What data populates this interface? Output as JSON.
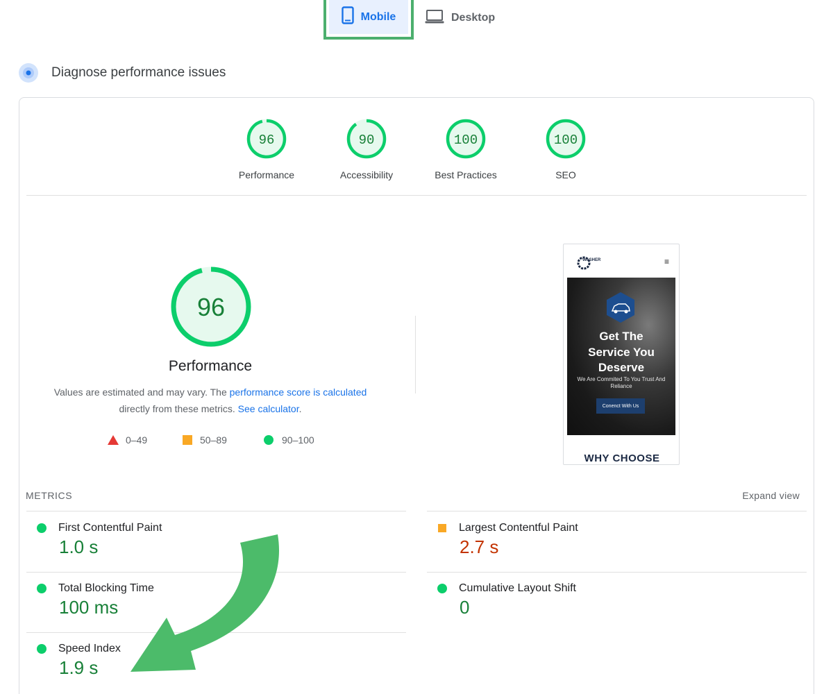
{
  "tabs": {
    "mobile": {
      "label": "Mobile",
      "icon": "phone-icon",
      "selected": true
    },
    "desktop": {
      "label": "Desktop",
      "icon": "laptop-icon",
      "selected": false
    }
  },
  "header": {
    "title": "Diagnose performance issues",
    "icon": "diagnose-icon"
  },
  "categories": [
    {
      "score": "96",
      "label": "Performance",
      "value": 96
    },
    {
      "score": "90",
      "label": "Accessibility",
      "value": 90
    },
    {
      "score": "100",
      "label": "Best Practices",
      "value": 100
    },
    {
      "score": "100",
      "label": "SEO",
      "value": 100
    }
  ],
  "performance": {
    "score": "96",
    "value": 96,
    "title": "Performance",
    "desc_prefix": "Values are estimated and may vary. The ",
    "desc_link": "performance score is calculated",
    "desc_middle": "directly from these metrics. ",
    "calculator_link": "See calculator",
    "desc_suffix": "."
  },
  "legend": [
    {
      "shape": "triangle",
      "range": "0–49",
      "color": "#e53935"
    },
    {
      "shape": "square",
      "range": "50–89",
      "color": "#f9a825"
    },
    {
      "shape": "circle",
      "range": "90–100",
      "color": "#0cce6b"
    }
  ],
  "screenshot": {
    "logo_text": "WASHER",
    "menu_icon": "≡",
    "hero_title_1": "Get The",
    "hero_title_2": "Service You",
    "hero_title_3": "Deserve",
    "hero_sub": "We Are Commited To You Trust And Reliance",
    "hero_button": "Conenct With Us",
    "section_heading": "WHY CHOOSE"
  },
  "metrics": {
    "title": "METRICS",
    "expand_label": "Expand view",
    "items": [
      {
        "name": "First Contentful Paint",
        "value": "1.0 s",
        "status": "pass"
      },
      {
        "name": "Largest Contentful Paint",
        "value": "2.7 s",
        "status": "average"
      },
      {
        "name": "Total Blocking Time",
        "value": "100 ms",
        "status": "pass"
      },
      {
        "name": "Cumulative Layout Shift",
        "value": "0",
        "status": "pass"
      },
      {
        "name": "Speed Index",
        "value": "1.9 s",
        "status": "pass"
      }
    ]
  },
  "colors": {
    "pass": "#0cce6b",
    "pass_text": "#188038",
    "average": "#f9a825",
    "average_text": "#c33300",
    "link": "#1a73e8",
    "arrow": "#4cbb6a"
  }
}
